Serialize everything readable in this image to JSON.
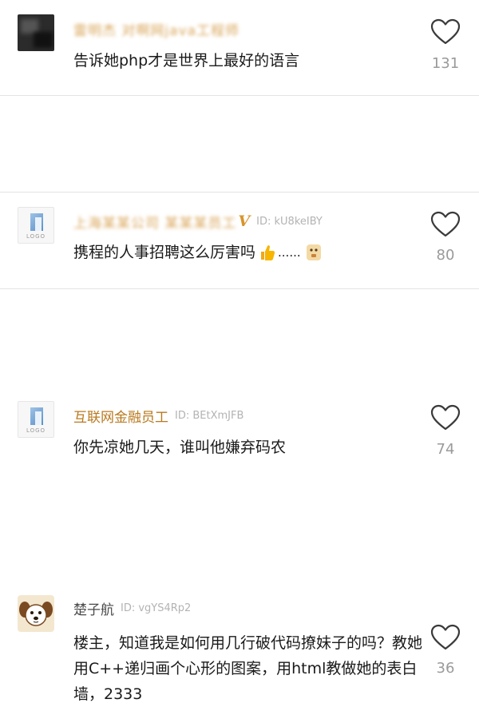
{
  "comments": [
    {
      "name": "雷明杰 对啊网java工程师",
      "id": "",
      "text": "告诉她php才是世界上最好的语言",
      "likes": "131"
    },
    {
      "name": "上海某某公司 某某某员工",
      "badge": "V",
      "id": "ID: kU8keIBY",
      "text": "携程的人事招聘这么厉害吗",
      "dots": "......",
      "likes": "80"
    },
    {
      "name": "互联网金融员工",
      "id": "ID: BEtXmJFB",
      "text": "你先凉她几天，谁叫他嫌弃码农",
      "likes": "74"
    },
    {
      "name": "楚子航",
      "id": "ID: vgYS4Rp2",
      "text": "楼主，知道我是如何用几行破代码撩妹子的吗？教她用C++递归画个心形的图案，用html教做她的表白墙，2333",
      "likes": "36"
    }
  ],
  "avatar_logo_text": "LOGO",
  "icons": {
    "like": "heart-outline-icon",
    "thumbs": "thumbs-up-emoji-icon",
    "face": "face-emoji-icon"
  },
  "colors": {
    "name_gold": "#b9791e",
    "uid_gray": "#b3b3b3",
    "count_gray": "#9a9a9a",
    "divider": "#e3e3e3"
  }
}
